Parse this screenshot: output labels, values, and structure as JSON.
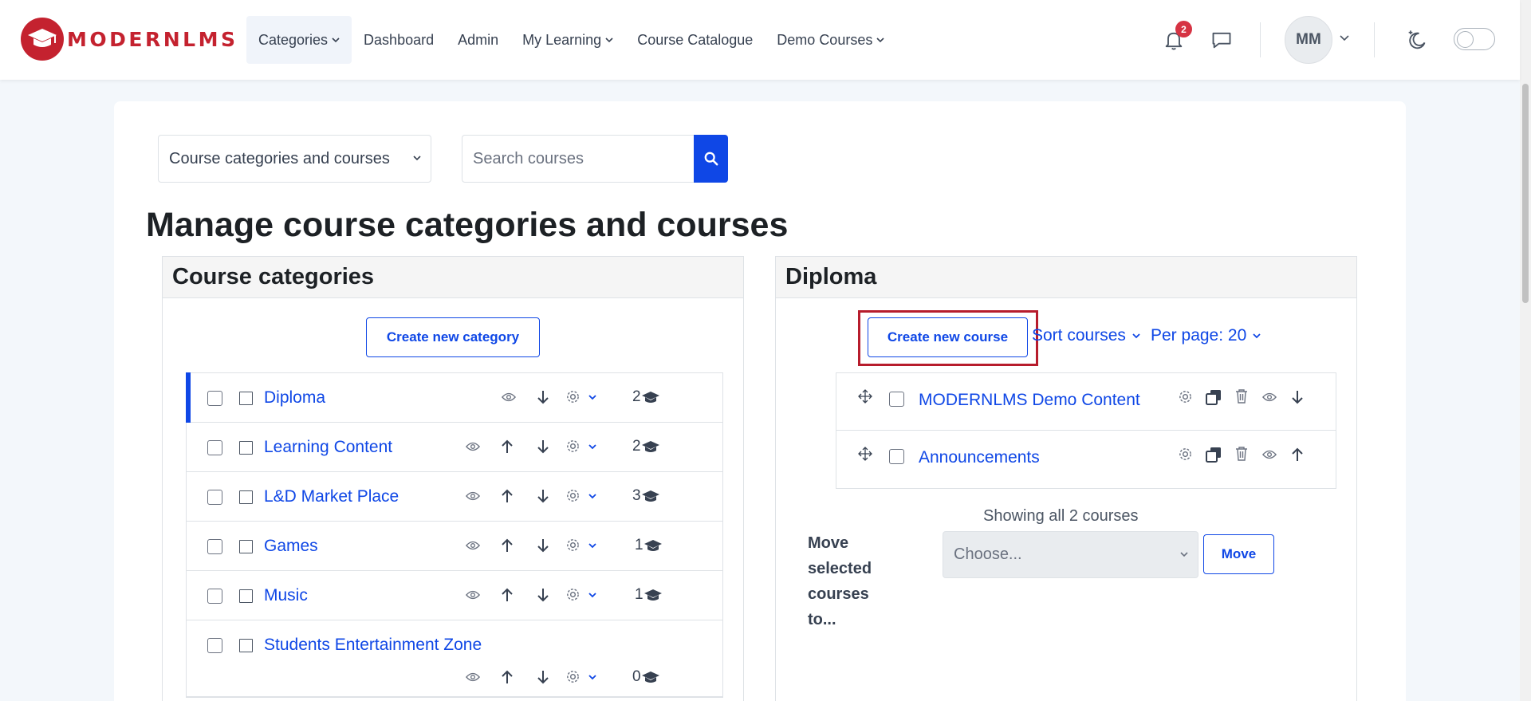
{
  "brand": {
    "name": "MODERNLMS",
    "color": "#c4222f"
  },
  "nav": {
    "items": [
      {
        "label": "Categories",
        "has_caret": true,
        "active": true
      },
      {
        "label": "Dashboard"
      },
      {
        "label": "Admin"
      },
      {
        "label": "My Learning",
        "has_caret": true
      },
      {
        "label": "Course Catalogue"
      },
      {
        "label": "Demo Courses",
        "has_caret": true
      }
    ],
    "notification_count": "2",
    "user_initials": "MM"
  },
  "toolbar": {
    "view_select": "Course categories and courses",
    "search_placeholder": "Search courses"
  },
  "page_title": "Manage course categories and courses",
  "categories_panel": {
    "title": "Course categories",
    "create_button": "Create new category",
    "items": [
      {
        "name": "Diploma",
        "count": "2",
        "selected": true
      },
      {
        "name": "Learning Content",
        "count": "2"
      },
      {
        "name": "L&D Market Place",
        "count": "3"
      },
      {
        "name": "Games",
        "count": "1"
      },
      {
        "name": "Music",
        "count": "1"
      },
      {
        "name": "Students Entertainment Zone",
        "count": "0"
      }
    ]
  },
  "courses_panel": {
    "title": "Diploma",
    "create_button": "Create new course",
    "sort_label": "Sort courses",
    "per_page_label": "Per page: 20",
    "courses": [
      {
        "name": "MODERNLMS Demo Content"
      },
      {
        "name": "Announcements"
      }
    ],
    "showing_text": "Showing all 2 courses",
    "move_label": "Move selected courses to...",
    "move_select_placeholder": "Choose...",
    "move_button": "Move"
  },
  "colors": {
    "primary": "#0f47e6",
    "highlight": "#b71c2c",
    "badge": "#d63343"
  }
}
